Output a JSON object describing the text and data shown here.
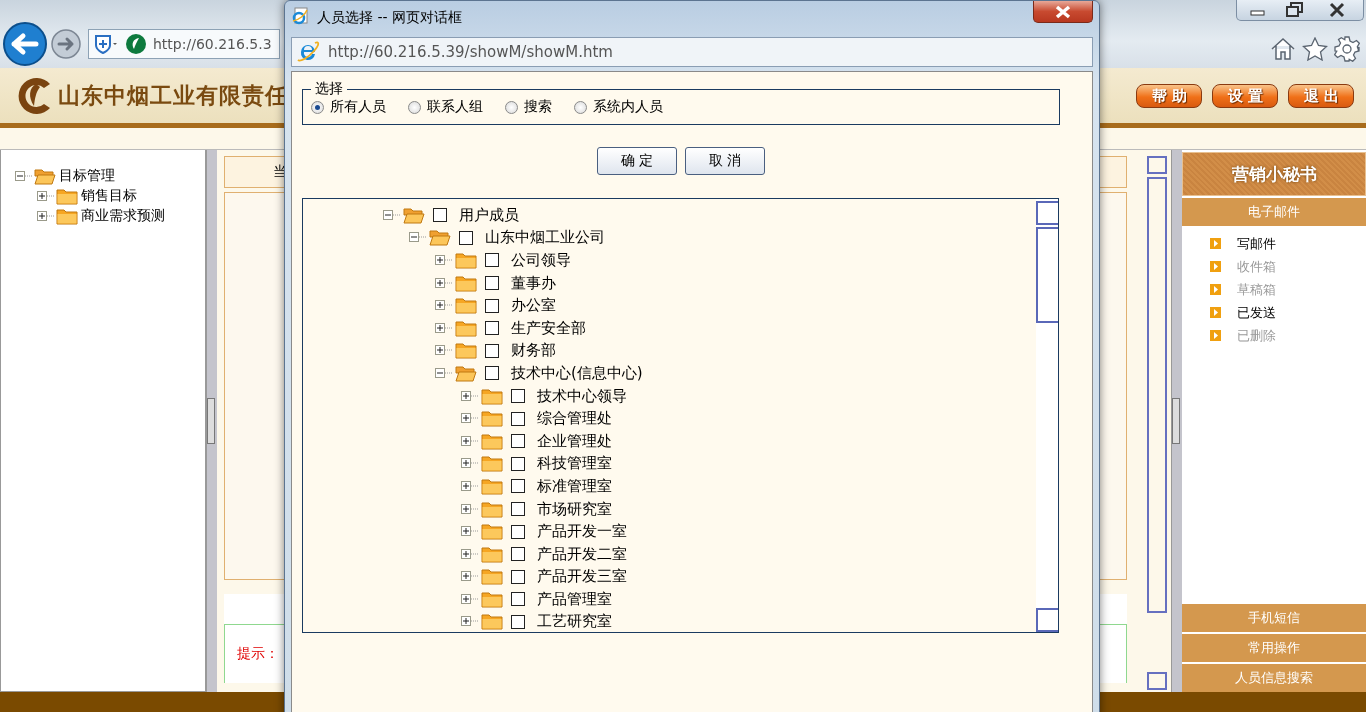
{
  "browser": {
    "address": "http://60.216.5.3"
  },
  "header": {
    "title": "山东中烟工业有限责任",
    "buttons": [
      "帮助",
      "设置",
      "退出"
    ]
  },
  "left_tree": [
    {
      "label": "目标管理",
      "expanded": true,
      "children": [
        {
          "label": "销售目标",
          "expanded": false
        },
        {
          "label": "商业需求预测",
          "expanded": false
        }
      ]
    }
  ],
  "content": {
    "header_text": "当",
    "hint": "提示："
  },
  "assistant": {
    "title": "营销小秘书",
    "sections": [
      {
        "label": "电子邮件",
        "items": [
          {
            "label": "写邮件",
            "disabled": false
          },
          {
            "label": "收件箱",
            "disabled": true
          },
          {
            "label": "草稿箱",
            "disabled": true
          },
          {
            "label": "已发送",
            "disabled": false
          },
          {
            "label": "已删除",
            "disabled": true
          }
        ]
      },
      {
        "label": "手机短信"
      },
      {
        "label": "常用操作"
      },
      {
        "label": "人员信息搜索"
      }
    ]
  },
  "dialog": {
    "title": "人员选择 -- 网页对话框",
    "address": "http://60.216.5.39/showM/showM.htm",
    "group_label": "选择",
    "options": [
      {
        "label": "所有人员",
        "selected": true
      },
      {
        "label": "联系人组",
        "selected": false
      },
      {
        "label": "搜索",
        "selected": false
      },
      {
        "label": "系统内人员",
        "selected": false
      }
    ],
    "buttons": [
      "确 定",
      "取 消"
    ],
    "tree": [
      {
        "label": "用户成员",
        "expanded": true,
        "checked": false,
        "children": [
          {
            "label": "山东中烟工业公司",
            "expanded": true,
            "checked": false,
            "children": [
              {
                "label": "公司领导",
                "expanded": false,
                "checked": false
              },
              {
                "label": "董事办",
                "expanded": false,
                "checked": false
              },
              {
                "label": "办公室",
                "expanded": false,
                "checked": false
              },
              {
                "label": "生产安全部",
                "expanded": false,
                "checked": false
              },
              {
                "label": "财务部",
                "expanded": false,
                "checked": false
              },
              {
                "label": "技术中心(信息中心)",
                "expanded": true,
                "checked": false,
                "children": [
                  {
                    "label": "技术中心领导",
                    "expanded": false,
                    "checked": false
                  },
                  {
                    "label": "综合管理处",
                    "expanded": false,
                    "checked": false
                  },
                  {
                    "label": "企业管理处",
                    "expanded": false,
                    "checked": false
                  },
                  {
                    "label": "科技管理室",
                    "expanded": false,
                    "checked": false
                  },
                  {
                    "label": "标准管理室",
                    "expanded": false,
                    "checked": false
                  },
                  {
                    "label": "市场研究室",
                    "expanded": false,
                    "checked": false
                  },
                  {
                    "label": "产品开发一室",
                    "expanded": false,
                    "checked": false
                  },
                  {
                    "label": "产品开发二室",
                    "expanded": false,
                    "checked": false
                  },
                  {
                    "label": "产品开发三室",
                    "expanded": false,
                    "checked": false
                  },
                  {
                    "label": "产品管理室",
                    "expanded": false,
                    "checked": false
                  },
                  {
                    "label": "工艺研究室",
                    "expanded": false,
                    "checked": false
                  }
                ]
              }
            ]
          }
        ]
      }
    ]
  }
}
